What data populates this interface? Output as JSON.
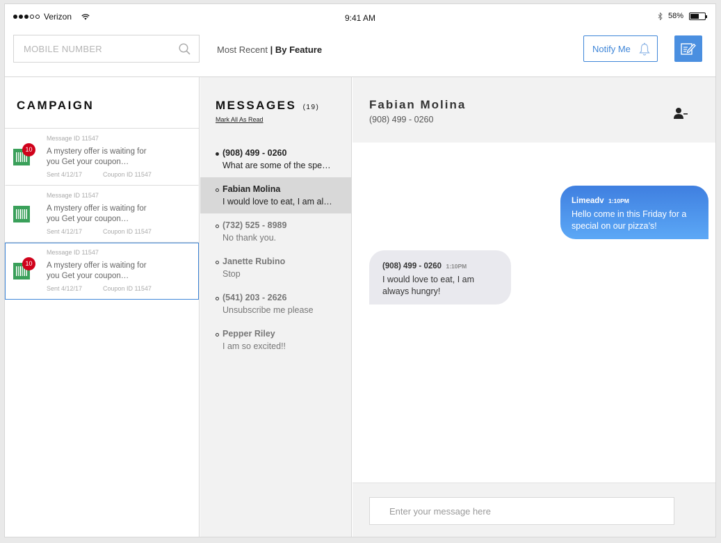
{
  "status_bar": {
    "carrier": "Verizon",
    "time": "9:41 AM",
    "battery": "58%",
    "battery_level": 0.58
  },
  "search": {
    "placeholder": "MOBILE NUMBER"
  },
  "sort": {
    "option_recent": "Most Recent",
    "option_feature": "| By Feature"
  },
  "notify": {
    "label": "Notify Me"
  },
  "campaign": {
    "title": "CAMPAIGN",
    "items": [
      {
        "message_id": "Message ID 11547",
        "text": "A mystery offer is waiting for you Get your coupon…",
        "sent": "Sent 4/12/17",
        "coupon_id": "Coupon ID 11547",
        "badge": "10"
      },
      {
        "message_id": "Message ID 11547",
        "text": "A mystery offer is waiting for you Get your coupon…",
        "sent": "Sent 4/12/17",
        "coupon_id": "Coupon ID 11547",
        "badge": ""
      },
      {
        "message_id": "Message ID 11547",
        "text": "A mystery offer is waiting for you Get your coupon…",
        "sent": "Sent 4/12/17",
        "coupon_id": "Coupon ID 11547",
        "badge": "10"
      }
    ]
  },
  "messages": {
    "title": "MESSAGES",
    "count": "(19)",
    "mark_all": "Mark All As Read",
    "items": [
      {
        "name": "(908) 499 - 0260",
        "preview": "What are some of the specials today?"
      },
      {
        "name": "Fabian Molina",
        "preview": "I would love to eat, I am always hungry!"
      },
      {
        "name": "(732) 525 - 8989",
        "preview": "No thank you."
      },
      {
        "name": "Janette Rubino",
        "preview": "Stop"
      },
      {
        "name": "(541) 203 - 2626",
        "preview": "Unsubscribe me please"
      },
      {
        "name": "Pepper Riley",
        "preview": "I am so excited!!"
      }
    ]
  },
  "conversation": {
    "name": "Fabian Molina",
    "phone": "(908) 499 - 0260",
    "outgoing": {
      "sender": "Limeadv",
      "time": "1:10PM",
      "body": "Hello come in this Friday for a special on our pizza’s!"
    },
    "incoming": {
      "sender": "(908) 499 - 0260",
      "time": "1:10PM",
      "body": "I would love to eat, I am always hungry!"
    },
    "composer_placeholder": "Enter your message here"
  },
  "colors": {
    "accent": "#3f86d8",
    "badge": "#d0021b",
    "barcode_tile": "#3aa05a"
  },
  "icons": [
    "wifi-icon",
    "bluetooth-icon",
    "battery-icon",
    "search-icon",
    "bell-icon",
    "compose-icon",
    "barcode-icon",
    "remove-user-icon"
  ]
}
